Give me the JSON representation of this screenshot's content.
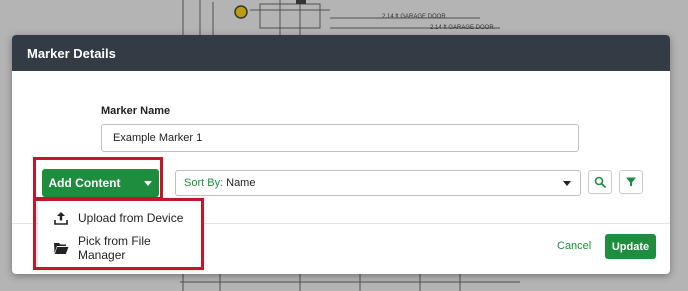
{
  "blueprint": {
    "labels": [
      "2.14 ft GARAGE DOOR",
      "2.14 ft GARAGE DOOR"
    ]
  },
  "modal": {
    "title": "Marker Details",
    "marker_name_label": "Marker Name",
    "marker_name_value": "Example Marker 1"
  },
  "toolbar": {
    "add_content_label": "Add Content",
    "sort_prefix": "Sort By:",
    "sort_value": "Name",
    "search_icon": "search-icon",
    "filter_icon": "filter-icon"
  },
  "add_content_menu": {
    "items": [
      {
        "label": "Upload from Device",
        "icon": "upload-icon"
      },
      {
        "label": "Pick from File Manager",
        "icon": "folder-open-icon"
      }
    ]
  },
  "footer": {
    "cancel_label": "Cancel",
    "update_label": "Update"
  },
  "colors": {
    "accent_green": "#1e8e3e",
    "header_bg": "#333b45",
    "highlight_red": "#c0172a"
  }
}
